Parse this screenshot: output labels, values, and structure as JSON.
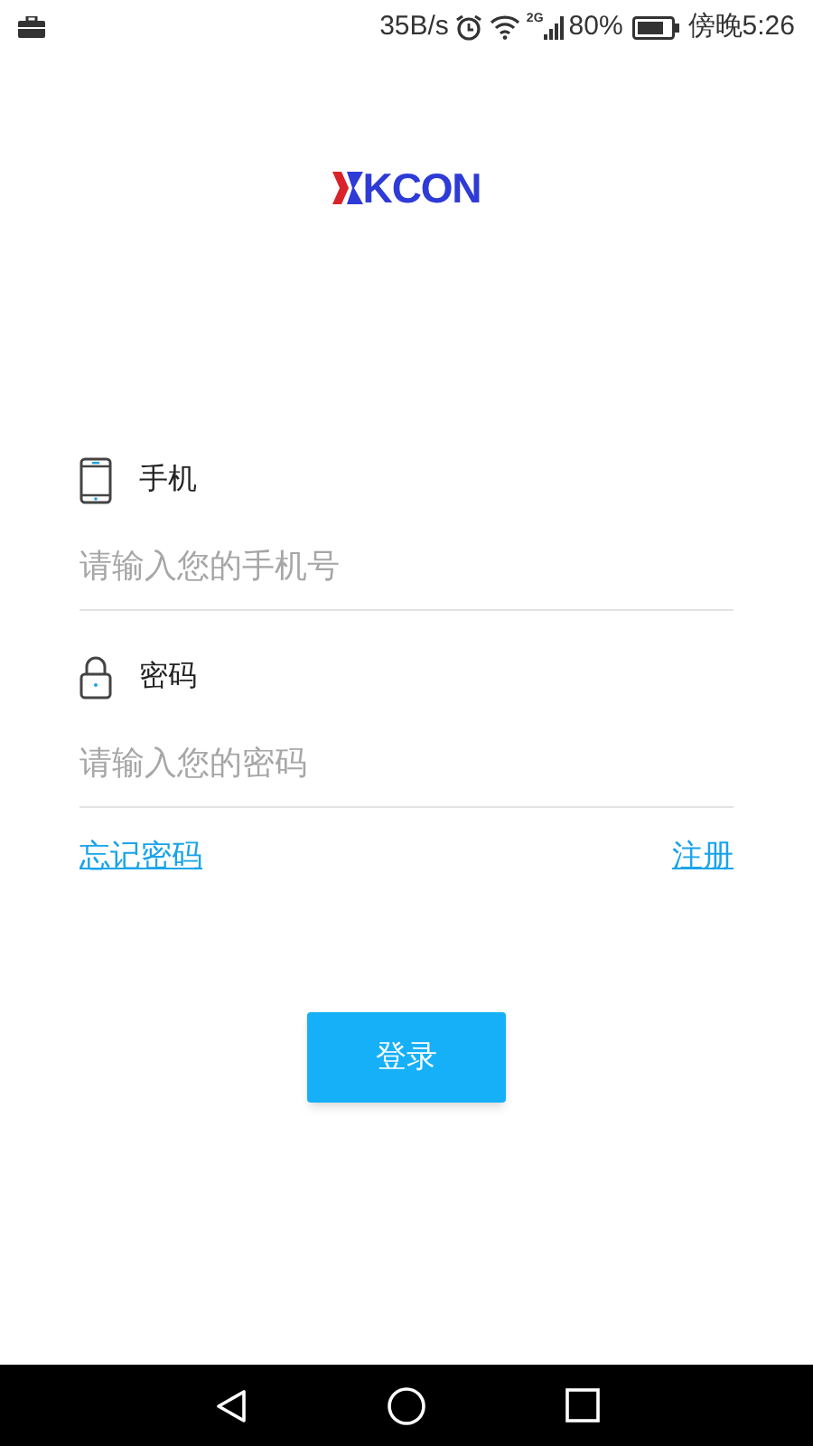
{
  "status_bar": {
    "net_speed": "35B/s",
    "network_type": "2G",
    "battery": "80%",
    "time": "傍晚5:26"
  },
  "logo": {
    "text": "KCON"
  },
  "fields": [
    {
      "kind": "phone",
      "label": "手机",
      "placeholder": "请输入您的手机号"
    },
    {
      "kind": "password",
      "label": "密码",
      "placeholder": "请输入您的密码"
    }
  ],
  "links": [
    "忘记密码",
    "注册"
  ],
  "login_button": "登录"
}
